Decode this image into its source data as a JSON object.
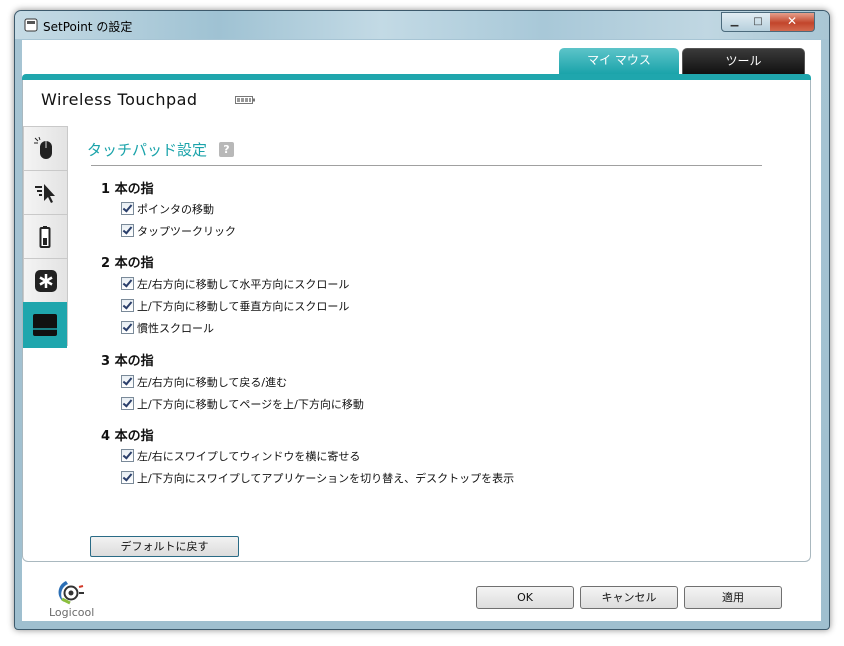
{
  "window": {
    "title": "SetPoint の設定"
  },
  "tabs": [
    {
      "label": "マイ マウス",
      "active": true
    },
    {
      "label": "ツール",
      "active": false
    }
  ],
  "device": {
    "name": "Wireless Touchpad"
  },
  "side_tabs": [
    {
      "icon": "mouse-icon"
    },
    {
      "icon": "pointer-speed-icon"
    },
    {
      "icon": "battery-icon"
    },
    {
      "icon": "asterisk-icon"
    },
    {
      "icon": "touchpad-icon",
      "active": true
    }
  ],
  "section": {
    "title": "タッチパッド設定",
    "help": "?"
  },
  "groups": [
    {
      "heading": "1 本の指",
      "options": [
        {
          "label": "ポインタの移動",
          "checked": true
        },
        {
          "label": "タップツークリック",
          "checked": true
        }
      ]
    },
    {
      "heading": "2 本の指",
      "options": [
        {
          "label": "左/右方向に移動して水平方向にスクロール",
          "checked": true
        },
        {
          "label": "上/下方向に移動して垂直方向にスクロール",
          "checked": true
        },
        {
          "label": "慣性スクロール",
          "checked": true
        }
      ]
    },
    {
      "heading": "3 本の指",
      "options": [
        {
          "label": "左/右方向に移動して戻る/進む",
          "checked": true
        },
        {
          "label": "上/下方向に移動してページを上/下方向に移動",
          "checked": true
        }
      ]
    },
    {
      "heading": "4 本の指",
      "options": [
        {
          "label": "左/右にスワイプしてウィンドウを横に寄せる",
          "checked": true
        },
        {
          "label": "上/下方向にスワイプしてアプリケーションを切り替え、デスクトップを表示",
          "checked": true
        }
      ]
    }
  ],
  "buttons": {
    "default": "デフォルトに戻す",
    "ok": "OK",
    "cancel": "キャンセル",
    "apply": "適用"
  },
  "brand": {
    "name": "Logicool"
  },
  "colors": {
    "accent": "#1fa6ad"
  }
}
